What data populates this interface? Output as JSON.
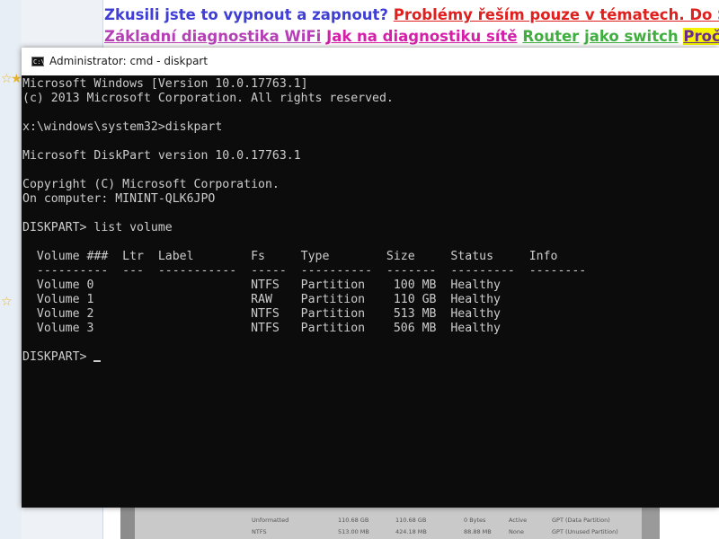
{
  "webpage": {
    "line1": {
      "question": "Zkusili jste to vypnout a zapnout?",
      "link": "Problémy řeším pouze v tématech. Do S"
    },
    "line2": {
      "link1": "Základní diagnostika WiFi",
      "link2": "Jak na diagnostiku sítě",
      "link3_a": "Router",
      "link3_b": "jako switch",
      "link4": "Proč"
    }
  },
  "window": {
    "title": "Administrator: cmd - diskpart",
    "icon": "cmd-icon"
  },
  "console": {
    "lines": [
      "Microsoft Windows [Version 10.0.17763.1]",
      "(c) 2013 Microsoft Corporation. All rights reserved.",
      "",
      "x:\\windows\\system32>diskpart",
      "",
      "Microsoft DiskPart version 10.0.17763.1",
      "",
      "Copyright (C) Microsoft Corporation.",
      "On computer: MININT-QLK6JPO",
      "",
      "DISKPART> list volume",
      "",
      "  Volume ###  Ltr  Label        Fs     Type        Size     Status     Info",
      "  ----------  ---  -----------  -----  ----------  -------  ---------  --------",
      "  Volume 0                      NTFS   Partition    100 MB  Healthy",
      "  Volume 1                      RAW    Partition    110 GB  Healthy",
      "  Volume 2                      NTFS   Partition    513 MB  Healthy",
      "  Volume 3                      NTFS   Partition    506 MB  Healthy",
      ""
    ],
    "prompt": "DISKPART> ",
    "input_value": ""
  },
  "photo": {
    "rows": [
      {
        "c1": "Unformatted",
        "c2": "110.68 GB",
        "c3": "110.68 GB",
        "c4": "0 Bytes",
        "c5": "Active",
        "c6": "GPT (Data Partition)"
      },
      {
        "c1": "NTFS",
        "c2": "513.00 MB",
        "c3": "424.18 MB",
        "c4": "88.88 MB",
        "c5": "None",
        "c6": "GPT (Unused Partition)"
      }
    ]
  },
  "colors": {
    "console_bg": "#0c0c0c",
    "console_fg": "#cccccc",
    "titlebar_bg": "#ffffff"
  }
}
